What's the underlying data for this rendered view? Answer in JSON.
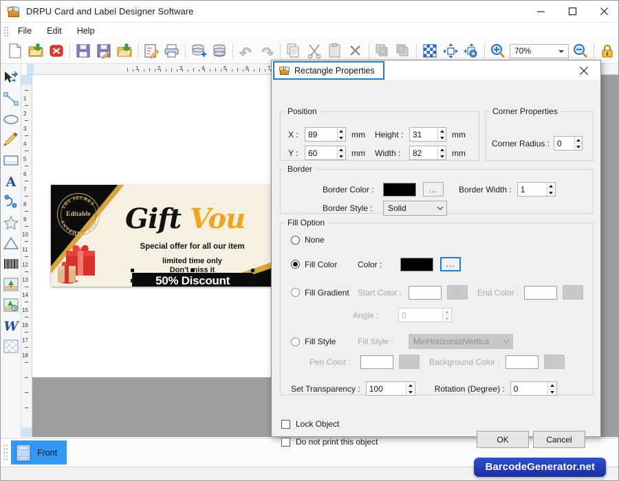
{
  "window": {
    "title": "DRPU Card and Label Designer Software",
    "app_icon": "package-box-icon",
    "minimize": "minimize-icon",
    "maximize": "maximize-icon",
    "close": "close-icon"
  },
  "menubar": {
    "items": [
      {
        "label": "File",
        "accel": "F"
      },
      {
        "label": "Edit",
        "accel": "E"
      },
      {
        "label": "Help",
        "accel": "H"
      }
    ]
  },
  "toolbar": {
    "zoom_value": "70%",
    "buttons": [
      {
        "name": "new-document-button",
        "icon": "new-page-icon"
      },
      {
        "name": "open-document-button",
        "icon": "open-folder-icon"
      },
      {
        "name": "close-document-button",
        "icon": "red-x-circle-icon"
      },
      {
        "name": "save-button",
        "icon": "floppy-disk-icon"
      },
      {
        "name": "save-as-button",
        "icon": "floppy-pencil-icon"
      },
      {
        "name": "import-button",
        "icon": "folder-up-arrow-icon"
      },
      {
        "name": "edit-design-button",
        "icon": "notepad-pencil-icon"
      },
      {
        "name": "print-button",
        "icon": "printer-icon"
      },
      {
        "name": "add-database-button",
        "icon": "database-plus-icon"
      },
      {
        "name": "database-button",
        "icon": "database-icon"
      },
      {
        "name": "undo-button",
        "icon": "undo-arrow-icon"
      },
      {
        "name": "redo-button",
        "icon": "redo-arrow-icon"
      },
      {
        "name": "copy-button",
        "icon": "copy-pages-icon"
      },
      {
        "name": "cut-button",
        "icon": "scissors-icon"
      },
      {
        "name": "paste-button",
        "icon": "clipboard-icon"
      },
      {
        "name": "delete-button",
        "icon": "x-delete-icon"
      },
      {
        "name": "bring-front-button",
        "icon": "layers-front-icon"
      },
      {
        "name": "send-back-button",
        "icon": "layers-back-icon"
      },
      {
        "name": "grid-button",
        "icon": "grid-checker-icon"
      },
      {
        "name": "align-object-button",
        "icon": "align-move-icon"
      },
      {
        "name": "object-settings-button",
        "icon": "object-gear-icon"
      },
      {
        "name": "zoom-in-button",
        "icon": "magnifier-plus-icon"
      },
      {
        "name": "zoom-out-button",
        "icon": "magnifier-minus-icon"
      },
      {
        "name": "lock-button",
        "icon": "padlock-closed-icon"
      },
      {
        "name": "unlock-button",
        "icon": "padlock-open-icon"
      }
    ]
  },
  "tool_palette": {
    "tools": [
      {
        "name": "select-tool",
        "icon": "arrow-move-icon"
      },
      {
        "name": "line-tool",
        "icon": "line-icon"
      },
      {
        "name": "ellipse-tool",
        "icon": "ellipse-icon"
      },
      {
        "name": "pencil-tool",
        "icon": "pencil-icon"
      },
      {
        "name": "rectangle-tool",
        "icon": "rectangle-icon"
      },
      {
        "name": "text-tool",
        "icon": "letter-a-icon"
      },
      {
        "name": "curve-tool",
        "icon": "bezier-curve-icon"
      },
      {
        "name": "star-tool",
        "icon": "star-icon"
      },
      {
        "name": "triangle-tool",
        "icon": "triangle-icon"
      },
      {
        "name": "barcode-tool",
        "icon": "barcode-icon"
      },
      {
        "name": "image-tool",
        "icon": "picture-tree-icon"
      },
      {
        "name": "watermark-tool",
        "icon": "picture-clock-icon"
      },
      {
        "name": "wordart-tool",
        "icon": "letter-w-icon"
      },
      {
        "name": "background-tool",
        "icon": "checkerboard-icon"
      }
    ]
  },
  "rulers": {
    "horizontal_marks": [
      "1",
      "2",
      "3",
      "4",
      "5",
      "6",
      "7"
    ],
    "vertical_marks": [
      "1",
      "2",
      "3",
      "4",
      "5",
      "6",
      "7",
      "8",
      "9",
      "10",
      "11",
      "12",
      "13",
      "14",
      "15",
      "16",
      "17",
      "18"
    ],
    "unit": "cm"
  },
  "canvas": {
    "voucher": {
      "seal_top_arc": "THE SECRET",
      "seal_center": "Editable",
      "seal_bottom_arc": "XYZ COMPANY",
      "title_part1": "Gift ",
      "title_part2": "Vou",
      "subtitle": "Special offer for all our item",
      "line_a": "limited time only",
      "line_b": "Don't miss it",
      "discount": "50% Discount",
      "gift_box_icon": "gift-box-icon",
      "colors": {
        "black": "#0c0c0c",
        "cream": "#f5f0e2",
        "gold": "#d8a43c",
        "orange": "#f0a51e"
      }
    }
  },
  "page_tabs": {
    "front": {
      "label": "Front",
      "icon": "card-front-icon"
    }
  },
  "brand": {
    "label": "BarcodeGenerator.net",
    "color": "#1a2f9e"
  },
  "dialog": {
    "title": "Rectangle Properties",
    "icon": "package-box-icon",
    "close": "close-icon",
    "position": {
      "legend": "Position",
      "x_label": "X :",
      "x_value": "89",
      "x_unit": "mm",
      "y_label": "Y :",
      "y_value": "60",
      "y_unit": "mm",
      "height_label": "Height :",
      "height_value": "31",
      "height_unit": "mm",
      "width_label": "Width :",
      "width_value": "82",
      "width_unit": "mm"
    },
    "corner": {
      "legend": "Corner Properties",
      "radius_label": "Corner Radius :",
      "radius_value": "0"
    },
    "border": {
      "legend": "Border",
      "color_label": "Border Color :",
      "color_value": "#000000",
      "color_browse": "...",
      "width_label": "Border Width :",
      "width_value": "1",
      "style_label": "Border Style :",
      "style_value": "Solid"
    },
    "fill": {
      "legend": "Fill Option",
      "none_label": "None",
      "fill_color_label": "Fill Color",
      "color_label": "Color :",
      "color_value": "#000000",
      "color_browse": "...",
      "fill_gradient_label": "Fill Gradient",
      "start_color_label": "Start Color :",
      "start_color_value": "#ffffff",
      "start_browse": "...",
      "end_color_label": "End Color :",
      "end_color_value": "#ffffff",
      "end_browse": "...",
      "angle_label": "Angle :",
      "angle_value": "0",
      "fill_style_label": "Fill Style",
      "style_label": "Fill Style :",
      "style_value": "MinHorizontalVertica",
      "pen_color_label": "Pen Color :",
      "pen_color_value": "#ffffff",
      "pen_browse": "...",
      "bg_color_label": "Background Color :",
      "bg_color_value": "#ffffff",
      "bg_browse": "...",
      "transparency_label": "Set Transparency :",
      "transparency_value": "100",
      "rotation_label": "Rotation (Degree) :",
      "rotation_value": "0",
      "selected": "fill_color"
    },
    "footer": {
      "lock_label": "Lock Object",
      "noprint_label": "Do not print this object",
      "ok_label": "OK",
      "cancel_label": "Cancel"
    }
  }
}
